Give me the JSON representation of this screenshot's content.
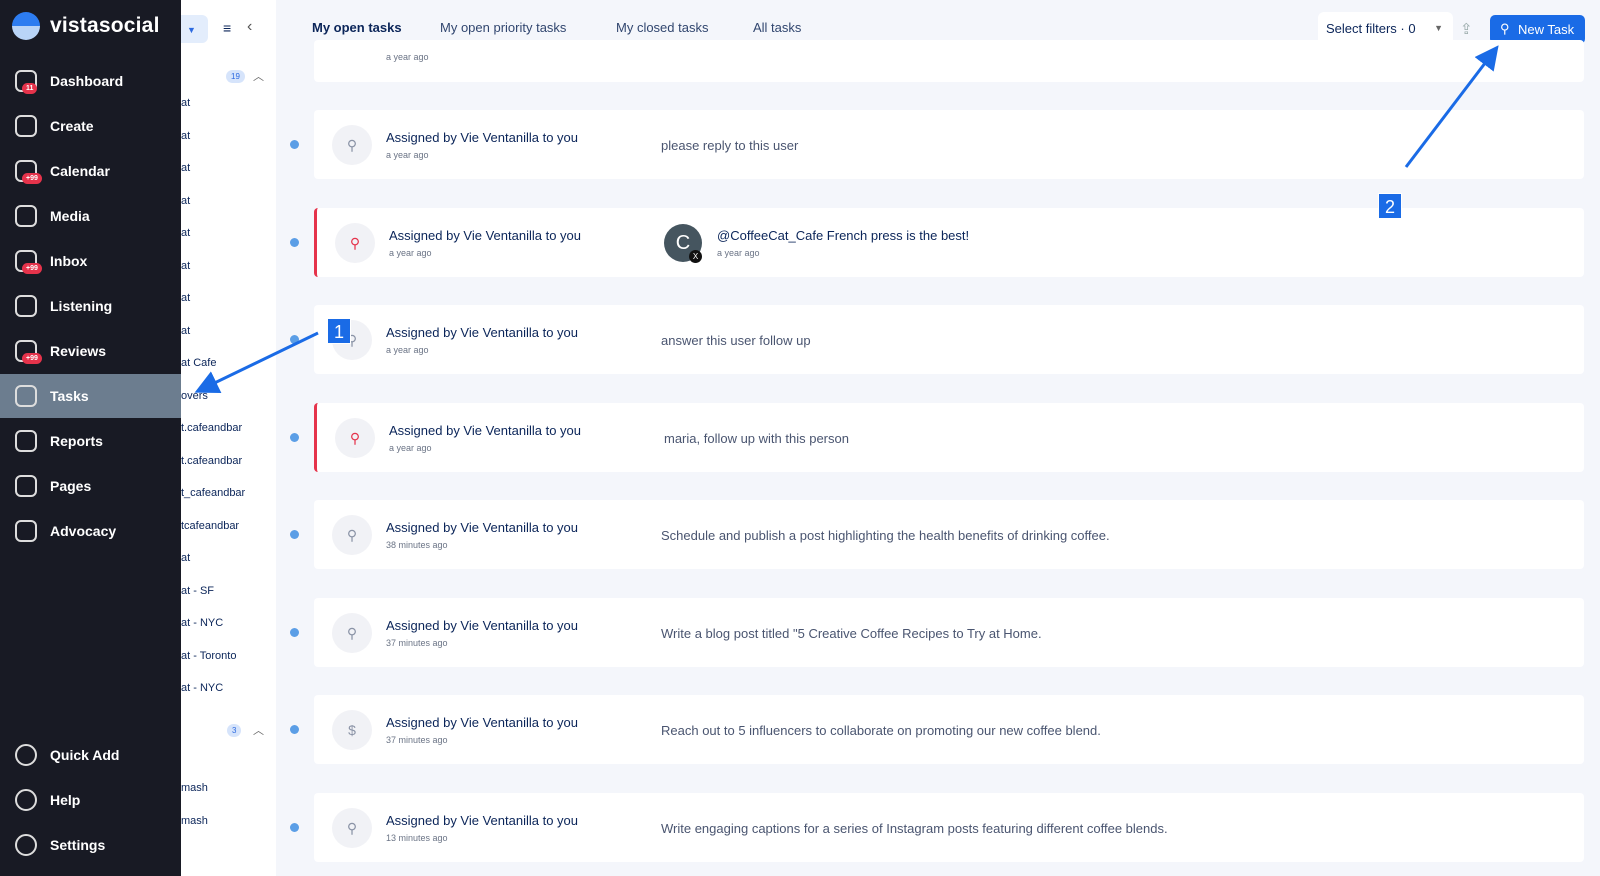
{
  "brand": {
    "name": "vistasocial"
  },
  "sidebar": {
    "items": [
      {
        "label": "Dashboard",
        "icon": "home-icon",
        "badge": "11"
      },
      {
        "label": "Create",
        "icon": "send-icon"
      },
      {
        "label": "Calendar",
        "icon": "calendar-icon",
        "badge": "+99"
      },
      {
        "label": "Media",
        "icon": "image-icon"
      },
      {
        "label": "Inbox",
        "icon": "inbox-icon",
        "badge": "+99"
      },
      {
        "label": "Listening",
        "icon": "waveform-icon"
      },
      {
        "label": "Reviews",
        "icon": "star-icon",
        "badge": "+99"
      },
      {
        "label": "Tasks",
        "icon": "check-square-icon",
        "active": true
      },
      {
        "label": "Reports",
        "icon": "chart-icon"
      },
      {
        "label": "Pages",
        "icon": "layout-icon"
      },
      {
        "label": "Advocacy",
        "icon": "megaphone-icon"
      }
    ],
    "bottom": [
      {
        "label": "Quick Add",
        "icon": "plus-circle-icon"
      },
      {
        "label": "Help",
        "icon": "help-icon"
      },
      {
        "label": "Settings",
        "icon": "settings-icon"
      }
    ]
  },
  "subpanel": {
    "dropdown": "3",
    "group1_count": "19",
    "group2_count": "3",
    "items": [
      "at",
      "at",
      "at",
      "at",
      "at",
      "at",
      "at",
      "at",
      "at Cafe",
      "overs",
      "t.cafeandbar",
      "t.cafeandbar",
      "t_cafeandbar",
      "tcafeandbar",
      "at",
      "at - SF",
      "at - NYC",
      "at - Toronto",
      "at - NYC"
    ],
    "items2": [
      "mash",
      "mash"
    ]
  },
  "tabs": [
    "My open tasks",
    "My open priority tasks",
    "My closed tasks",
    "All tasks"
  ],
  "filters": {
    "label": "Select filters · 0"
  },
  "new_task": "New Task",
  "colors": {
    "accent": "#1a6be6",
    "priority": "#e5334b",
    "sidebar": "#181a24"
  },
  "partial_time": "a year ago",
  "tasks": [
    {
      "assigned": "Assigned by Vie Ventanilla to you",
      "time": "a year ago",
      "desc": "please reply to this user",
      "priority": false,
      "icon": "pin-icon"
    },
    {
      "assigned": "Assigned by Vie Ventanilla to you",
      "time": "a year ago",
      "priority": true,
      "icon": "pin-icon",
      "post": {
        "avatar": "C",
        "text": "@CoffeeCat_Cafe French press is the best!",
        "time": "a year ago",
        "network": "X"
      }
    },
    {
      "assigned": "Assigned by Vie Ventanilla to you",
      "time": "a year ago",
      "desc": "answer this user follow up",
      "priority": false,
      "icon": "pin-icon"
    },
    {
      "assigned": "Assigned by Vie Ventanilla to you",
      "time": "a year ago",
      "desc": "maria, follow up with this person",
      "priority": true,
      "icon": "pin-icon"
    },
    {
      "assigned": "Assigned by Vie Ventanilla to you",
      "time": "38 minutes ago",
      "desc": "Schedule and publish a post highlighting the health benefits of drinking coffee.",
      "priority": false,
      "icon": "pin-icon"
    },
    {
      "assigned": "Assigned by Vie Ventanilla to you",
      "time": "37 minutes ago",
      "desc": "Write a blog post titled \"5 Creative Coffee Recipes to Try at Home.",
      "priority": false,
      "icon": "pin-icon"
    },
    {
      "assigned": "Assigned by Vie Ventanilla to you",
      "time": "37 minutes ago",
      "desc": "Reach out to 5 influencers to collaborate on promoting our new coffee blend.",
      "priority": false,
      "icon": "dollar-icon"
    },
    {
      "assigned": "Assigned by Vie Ventanilla to you",
      "time": "13 minutes ago",
      "desc": "Write engaging captions for a series of Instagram posts featuring different coffee blends.",
      "priority": false,
      "icon": "pin-icon"
    }
  ],
  "annotations": [
    "1",
    "2"
  ]
}
